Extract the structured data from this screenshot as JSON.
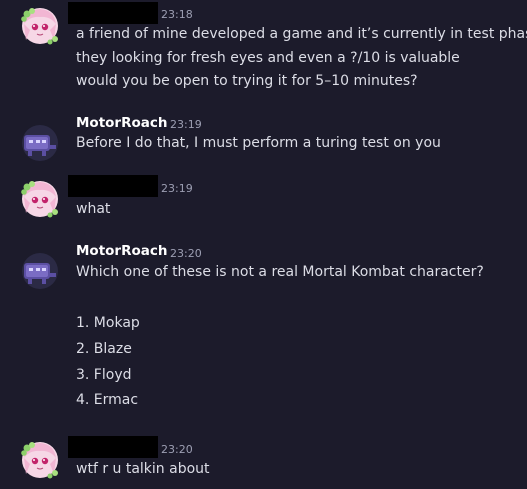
{
  "messages": [
    {
      "author": "",
      "time": "23:18",
      "lines": [
        "a friend of mine developed a game and it’s currently in test phase",
        "they looking for fresh eyes and even a ?/10 is valuable",
        "would you be open to trying it for 5–10 minutes?"
      ]
    },
    {
      "author": "MotorRoach",
      "time": "23:19",
      "lines": [
        "Before I do that, I must perform a turing test on you"
      ]
    },
    {
      "author": "",
      "time": "23:19",
      "lines": [
        "what"
      ]
    },
    {
      "author": "MotorRoach",
      "time": "23:20",
      "lines": [
        "Which one of these is not a real Mortal Kombat character?",
        "",
        "1. Mokap",
        "2. Blaze",
        "3. Floyd",
        "4. Ermac"
      ]
    },
    {
      "author": "",
      "time": "23:20",
      "lines": [
        "wtf r u talkin about"
      ]
    }
  ]
}
